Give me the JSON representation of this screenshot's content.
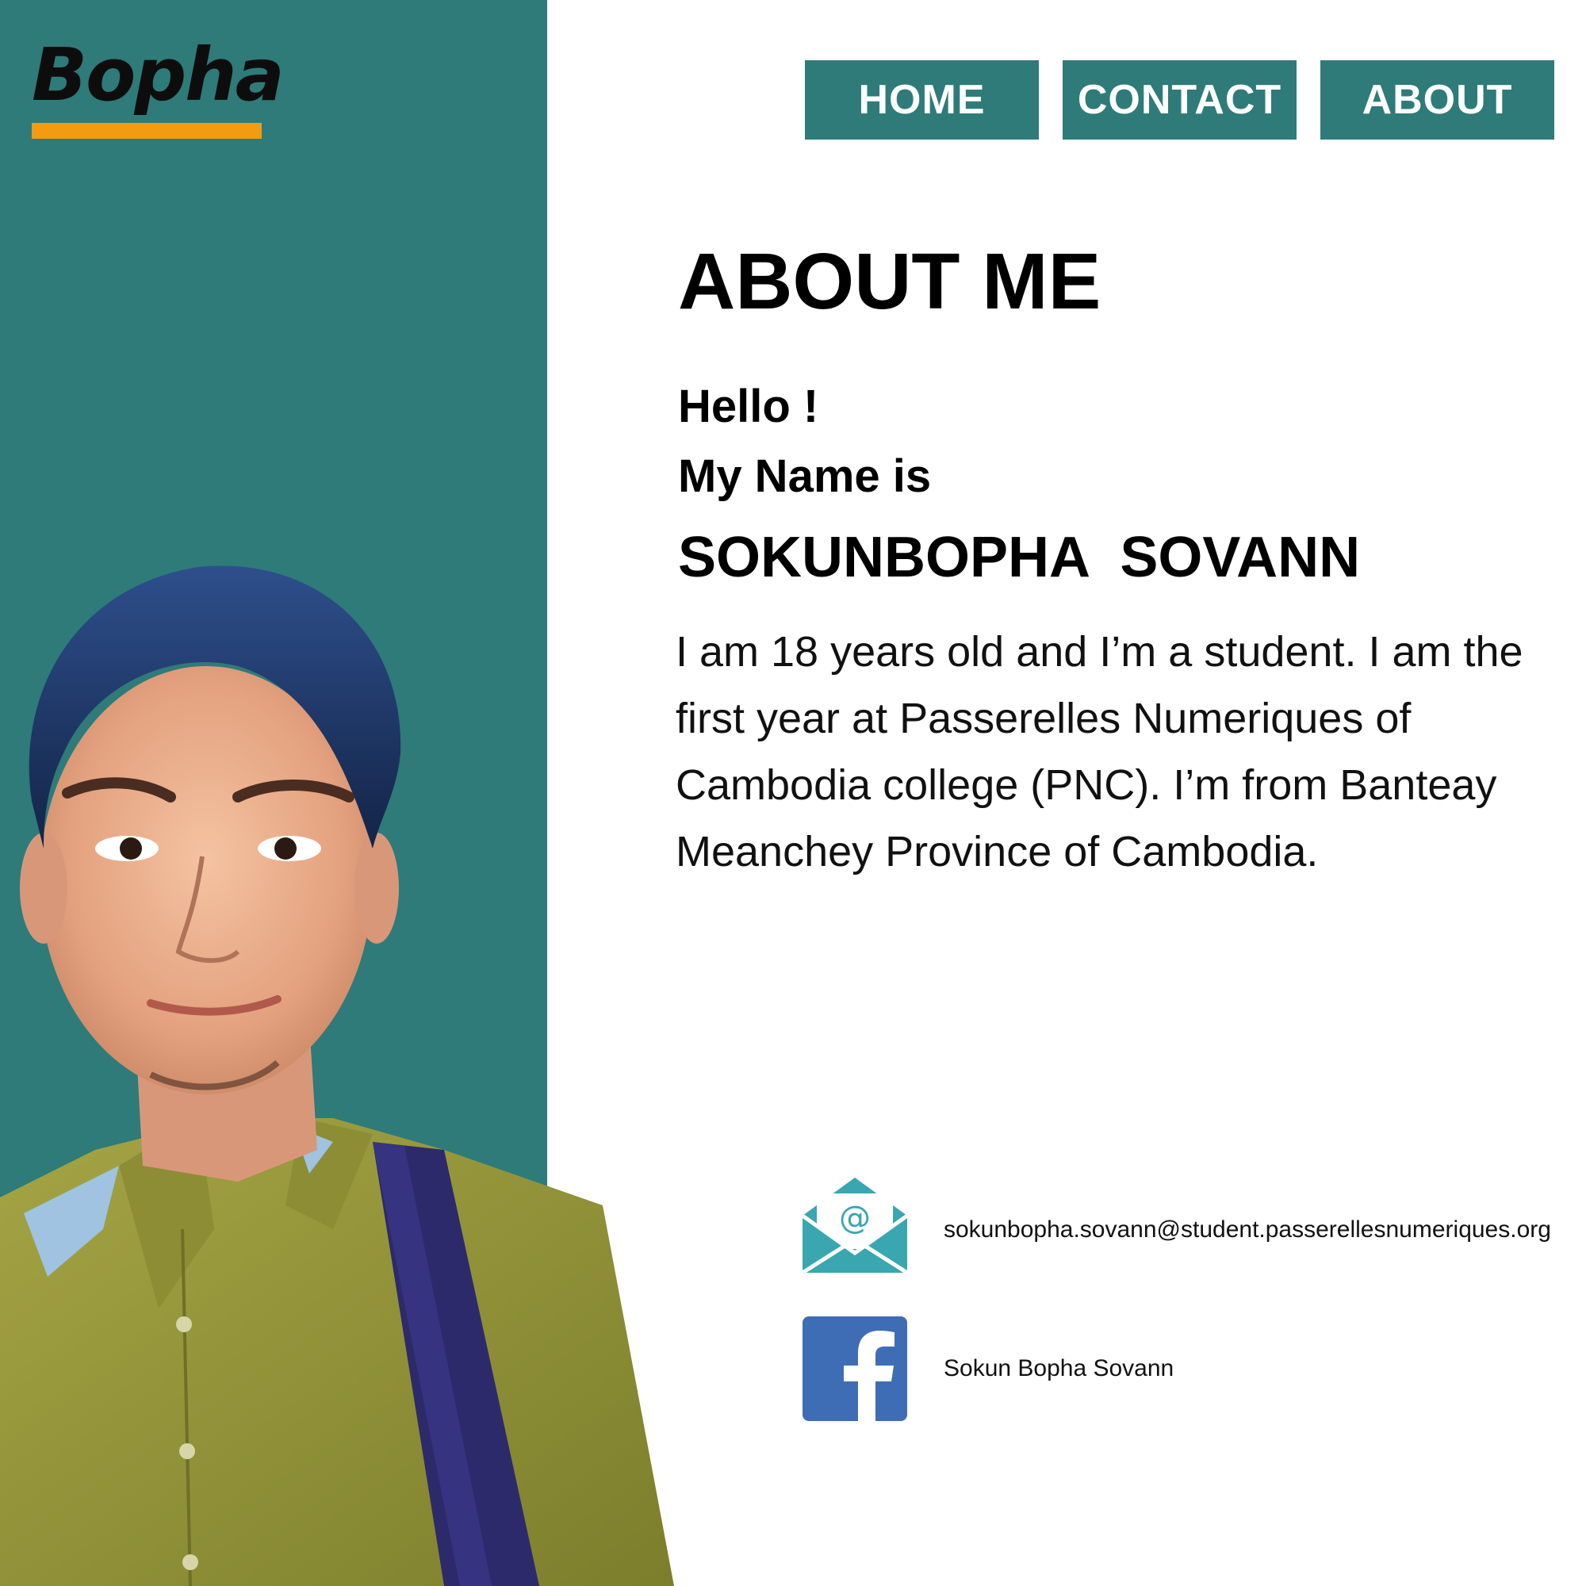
{
  "logo": {
    "text": "Bopha",
    "underline_color": "#f39c12"
  },
  "nav": {
    "items": [
      {
        "label": "HOME"
      },
      {
        "label": "CONTACT"
      },
      {
        "label": "ABOUT"
      }
    ]
  },
  "colors": {
    "primary": "#2e7b79",
    "accent": "#f39c12",
    "text": "#000000",
    "email_icon": "#3aa6b0",
    "facebook_icon": "#3f6db5"
  },
  "main": {
    "title": "ABOUT ME",
    "greeting": "Hello !",
    "name_intro": "My Name is",
    "full_name": "SOKUNBOPHA  SOVANN",
    "bio": "I am 18 years old and I’m a student. I am the first year at Passerelles Numeriques of Cambodia college (PNC). I’m from Banteay Meanchey Province of Cambodia."
  },
  "contacts": {
    "email": {
      "icon": "email-icon",
      "text": "sokunbopha.sovann@student.passerellesnumeriques.org"
    },
    "facebook": {
      "icon": "facebook-icon",
      "text": "Sokun Bopha Sovann"
    }
  },
  "photo": {
    "icon": "profile-photo"
  }
}
